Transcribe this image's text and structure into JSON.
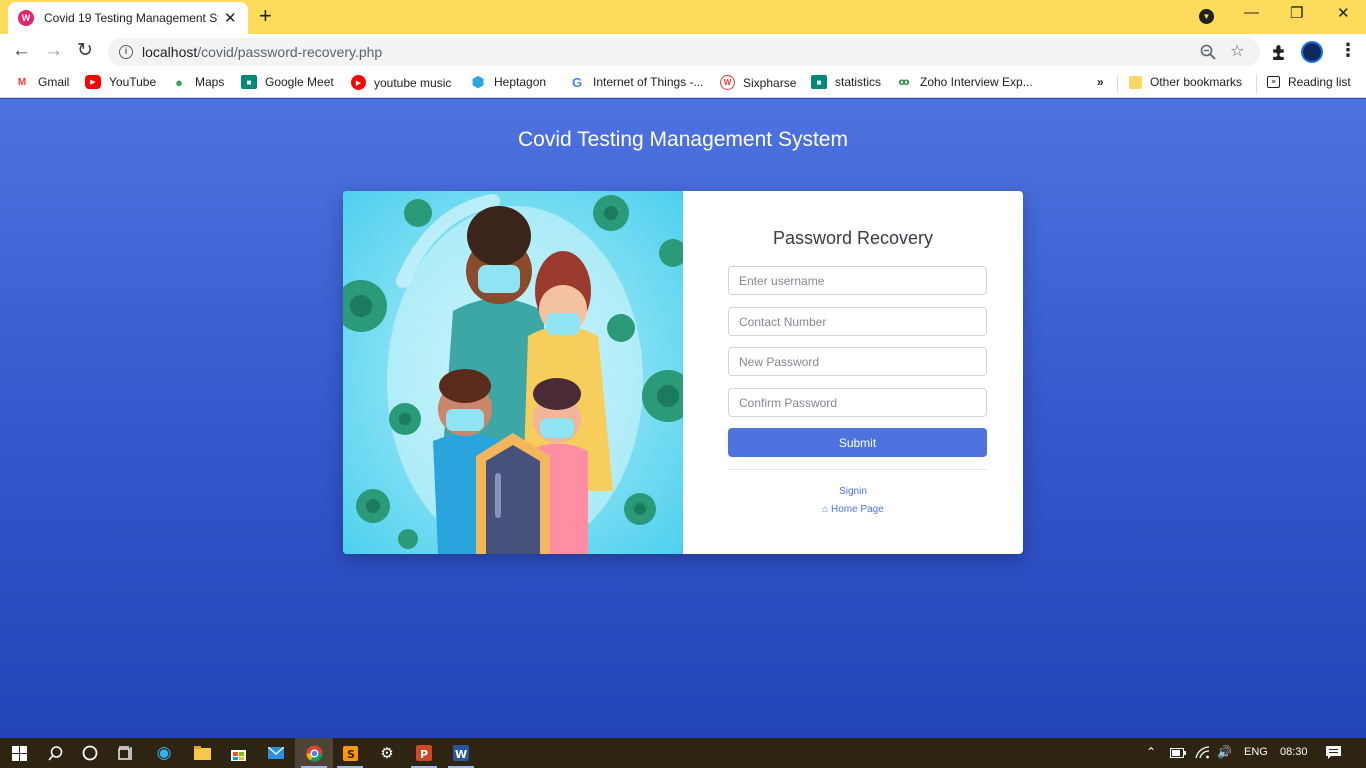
{
  "browser": {
    "tab_title": "Covid 19 Testing Management System",
    "tab_favicon": "W",
    "tab_close": "✕",
    "new_tab": "+",
    "url_host": "localhost",
    "url_path": "/covid/password-recovery.php",
    "controls": {
      "minimize": "—",
      "restore": "❐",
      "close": "✕"
    },
    "nav": {
      "back": "←",
      "forward": "→",
      "reload": "↻"
    },
    "overflow": "»"
  },
  "bookmarks": [
    {
      "label": "Gmail",
      "icon": "gmail-icon",
      "color": "#ea4335"
    },
    {
      "label": "YouTube",
      "icon": "youtube-icon",
      "color": "#ff0000"
    },
    {
      "label": "Maps",
      "icon": "maps-icon",
      "color": "#34a853"
    },
    {
      "label": "Google Meet",
      "icon": "meet-icon",
      "color": "#00897b"
    },
    {
      "label": "youtube music",
      "icon": "youtube-music-icon",
      "color": "#ff0000"
    },
    {
      "label": "Heptagon",
      "icon": "heptagon-icon",
      "color": "#29a8e0"
    },
    {
      "label": "Internet of Things -...",
      "icon": "google-icon",
      "color": "#4285f4"
    },
    {
      "label": "Sixpharse",
      "icon": "sixpharse-icon",
      "color": "#e53935"
    },
    {
      "label": "statistics",
      "icon": "meet-icon",
      "color": "#00897b"
    },
    {
      "label": "Zoho Interview Exp...",
      "icon": "geeks-icon",
      "color": "#2f8d46"
    }
  ],
  "other_bookmarks": "Other bookmarks",
  "reading_list": "Reading list",
  "page": {
    "site_title": "Covid Testing Management System",
    "form_title": "Password Recovery",
    "fields": {
      "username": "Enter username",
      "contact": "Contact Number",
      "new_password": "New Password",
      "confirm_password": "Confirm Password"
    },
    "submit_label": "Submit",
    "signin_link": "Signin",
    "home_link": "Home Page",
    "accent_color": "#4e73df"
  },
  "taskbar": {
    "language": "ENG",
    "time": "08:30"
  }
}
